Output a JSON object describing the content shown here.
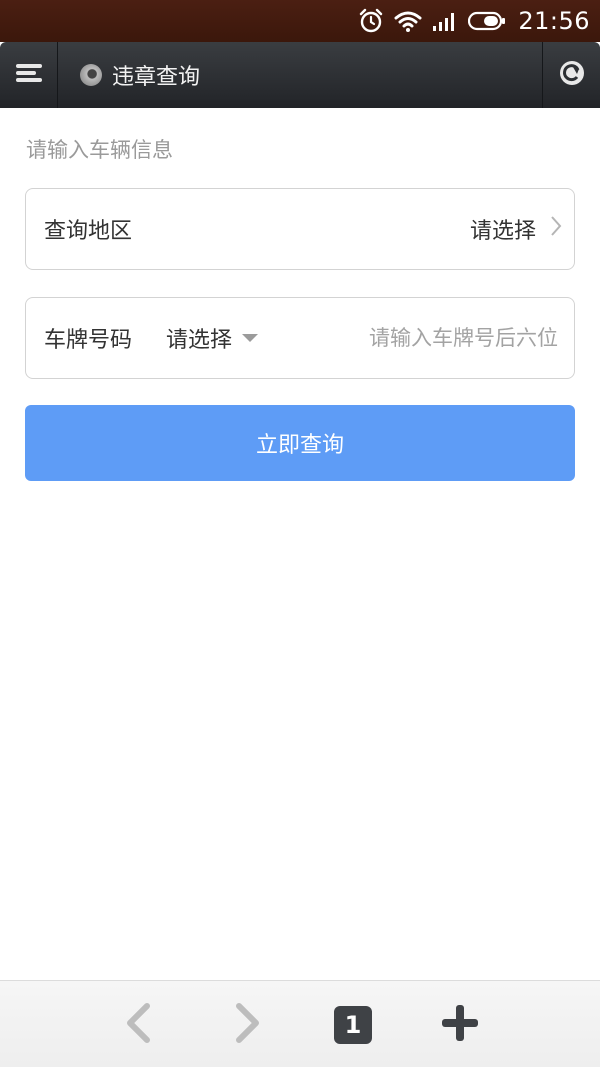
{
  "status_bar": {
    "time": "21:56",
    "icons": [
      "alarm-icon",
      "wifi-icon",
      "signal-icon",
      "battery-icon"
    ]
  },
  "toolbar": {
    "title": "违章查询",
    "icons": [
      "menu-icon",
      "site-icon",
      "refresh-icon"
    ]
  },
  "form": {
    "prompt": "请输入车辆信息",
    "region_label": "查询地区",
    "region_value": "请选择",
    "plate_label": "车牌号码",
    "plate_prefix_value": "请选择",
    "plate_placeholder": "请输入车牌号后六位",
    "plate_value": "",
    "submit_label": "立即查询"
  },
  "bottom_bar": {
    "tab_count": "1",
    "icons": [
      "back-icon",
      "forward-icon",
      "tabs-icon",
      "new-tab-icon"
    ]
  },
  "colors": {
    "status_bar": "#3b170b",
    "toolbar": "#2c2f33",
    "button": "#5e9cf6",
    "prompt_text": "#9a9a9a"
  }
}
